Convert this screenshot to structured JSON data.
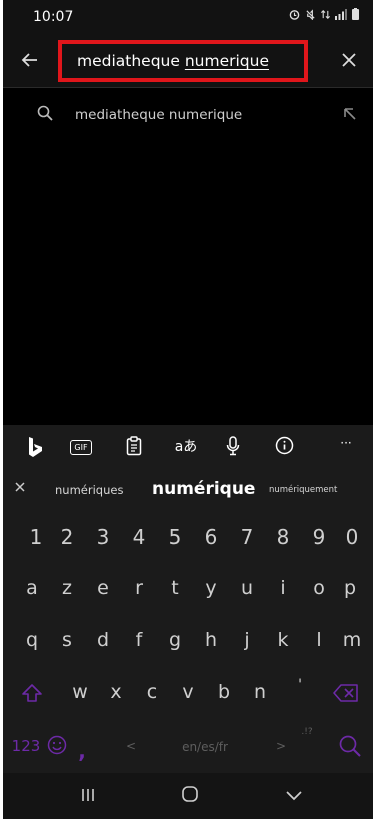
{
  "status_bar": {
    "time": "10:07"
  },
  "search": {
    "query_part1": "mediatheque ",
    "query_part2": "numerique"
  },
  "suggestions": [
    {
      "text": "mediatheque numerique"
    }
  ],
  "keyboard": {
    "predictions": [
      "numériques",
      "numérique",
      "numériquement"
    ],
    "number_row": [
      "1",
      "2",
      "3",
      "4",
      "5",
      "6",
      "7",
      "8",
      "9",
      "0"
    ],
    "row1": [
      "a",
      "z",
      "e",
      "r",
      "t",
      "y",
      "u",
      "i",
      "o",
      "p"
    ],
    "row2": [
      "q",
      "s",
      "d",
      "f",
      "g",
      "h",
      "j",
      "k",
      "l",
      "m"
    ],
    "row3": [
      "w",
      "x",
      "c",
      "v",
      "b",
      "n",
      "'"
    ],
    "bottom": {
      "symbols_key": "123",
      "comma_key": ",",
      "left_arrow": "<",
      "language": "en/es/fr",
      "right_arrow": ">",
      "punct_key": ".!?"
    },
    "toolbar": {
      "gif_label": "GIF",
      "translate_label": "aあ",
      "more_label": "···"
    }
  },
  "colors": {
    "accent_red": "#e0161b",
    "keyboard_purple": "#6d2aa7"
  }
}
